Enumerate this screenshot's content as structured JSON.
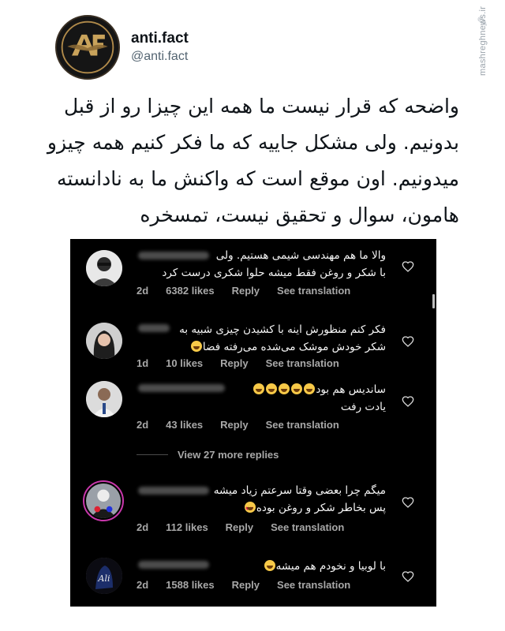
{
  "tweet": {
    "display_name": "anti.fact",
    "handle": "@anti.fact",
    "text_lines": [
      "واضحه که قرار نیست ما همه این چیزا رو از قبل",
      "بدونیم. ولی مشکل جاییه که ما فکر کنیم همه چیزو",
      "میدونیم. اون موقع است که واکنش ما به نادانسته",
      "هامون، سوال و تحقیق نیست، تمسخره"
    ],
    "avatar_logo_text": "AF"
  },
  "watermark": {
    "text": "mashreghnews.ir"
  },
  "comments": [
    {
      "lines": [
        "والا ما هم مهندسی شیمی هستیم. ولی",
        "با شکر  و روغن فقط میشه حلوا شکری درست کرد"
      ],
      "time": "2d",
      "likes": "6382 likes",
      "reply": "Reply",
      "translate": "See translation"
    },
    {
      "lines": [
        "فکر کنم منظورش اینه با کشیدن چیزی شبیه به",
        "شکر خودش موشک می‌شده می‌رفته فضا"
      ],
      "time": "1d",
      "likes": "10 likes",
      "reply": "Reply",
      "translate": "See translation"
    },
    {
      "lines": [
        "ساندیس هم بود",
        "یادت رفت"
      ],
      "time": "2d",
      "likes": "43 likes",
      "reply": "Reply",
      "translate": "See translation"
    },
    {
      "lines": [
        "میگم چرا بعضی وقتا سرعتم زیاد میشه",
        "پس بخاطر شکر و روغن بوده"
      ],
      "time": "2d",
      "likes": "112 likes",
      "reply": "Reply",
      "translate": "See translation"
    },
    {
      "lines": [
        "با لوبیا و نخودم هم میشه"
      ],
      "time": "2d",
      "likes": "1588 likes",
      "reply": "Reply",
      "translate": "See translation"
    }
  ],
  "view_more_replies": "View 27 more replies",
  "colors": {
    "ig_background": "#000000",
    "ig_meta_text": "#a8a8a8",
    "story_ring": "#c837ab"
  }
}
